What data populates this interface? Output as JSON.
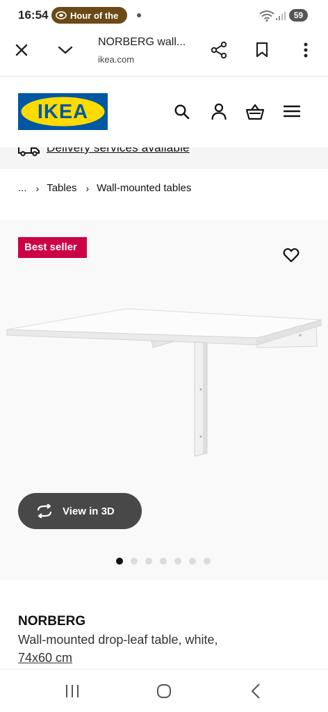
{
  "status_bar": {
    "time": "16:54",
    "notification_pill": "Hour of the",
    "battery": "59",
    "icons": [
      "wifi-icon",
      "signal-icon"
    ]
  },
  "browser": {
    "tab_title": "NORBERG wall...",
    "url": "ikea.com",
    "icons": [
      "close-icon",
      "chevron-down-icon",
      "share-icon",
      "bookmark-icon",
      "more-vert-icon"
    ]
  },
  "header": {
    "logo_text": "IKEA",
    "icons": [
      "search-icon",
      "profile-icon",
      "basket-icon",
      "menu-icon"
    ]
  },
  "delivery": {
    "text": "Delivery services available"
  },
  "breadcrumb": {
    "ellipsis": "...",
    "items": [
      "Tables",
      "Wall-mounted tables"
    ]
  },
  "gallery": {
    "badge": "Best seller",
    "view_3d_label": "View in 3D",
    "image_count": 7,
    "active_image": 1
  },
  "product": {
    "name": "NORBERG",
    "description": "Wall-mounted drop-leaf table, white,",
    "size": "74x60 cm"
  },
  "colors": {
    "ikea_blue": "#0058a3",
    "ikea_yellow": "#ffdb00",
    "badge_red": "#cc0045",
    "button_dark": "#484848"
  }
}
